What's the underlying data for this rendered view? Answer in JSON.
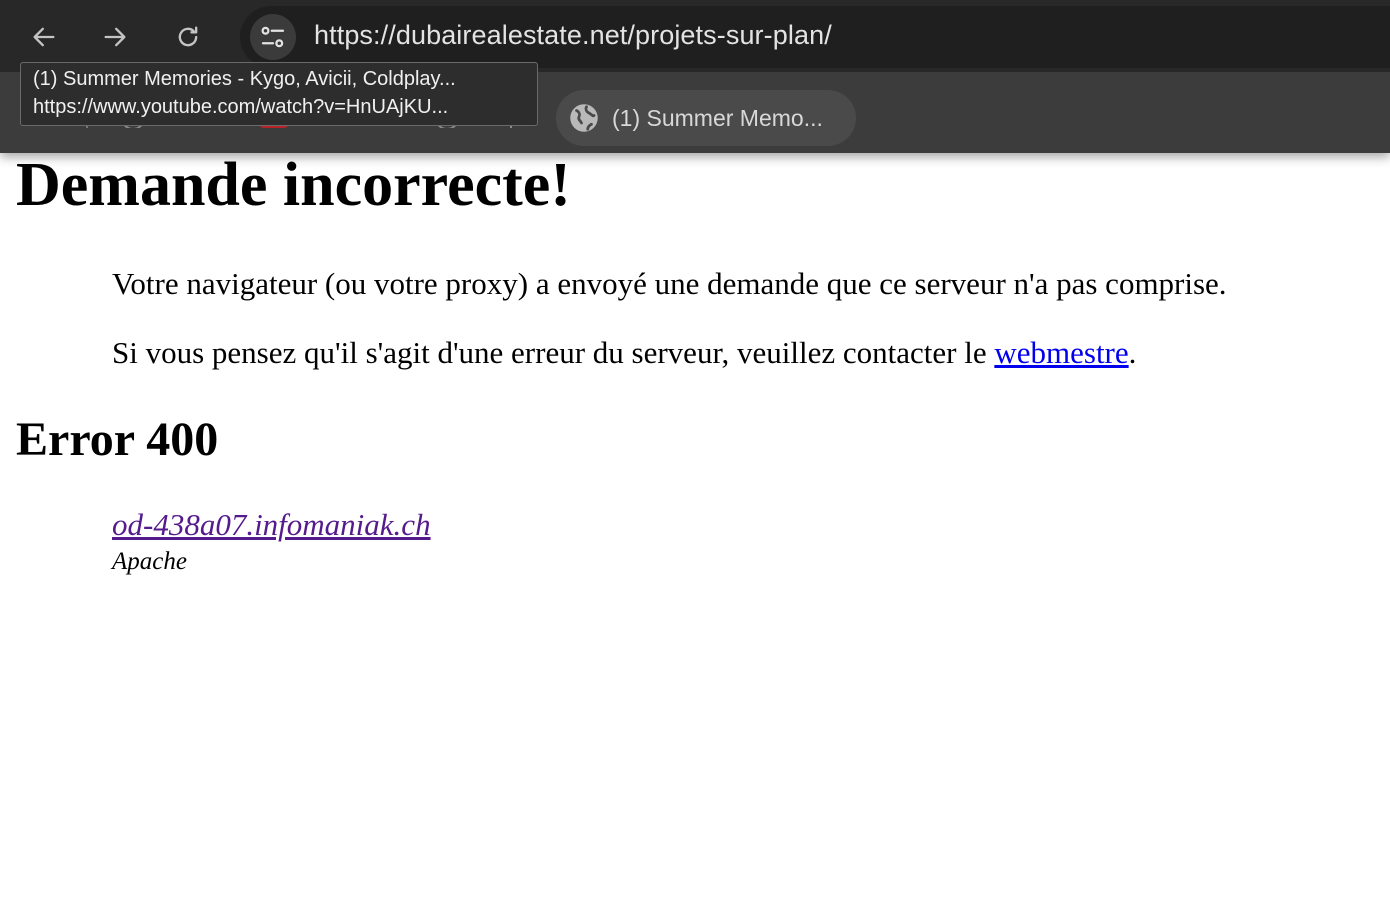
{
  "browser": {
    "url": "https://dubairealestate.net/projets-sur-plan/",
    "bookmark_chip_label": "(1) Summer Memo...",
    "tooltip": {
      "title": "(1) Summer Memories - Kygo, Avicii, Coldplay...",
      "url": "https://www.youtube.com/watch?v=HnUAjKU..."
    },
    "icons": {
      "back": "arrow-left-icon",
      "forward": "arrow-right-icon",
      "reload": "reload-icon",
      "site_info": "tune-icon",
      "bookmark": "globe-icon"
    }
  },
  "page": {
    "title": "Demande incorrecte!",
    "message": "Votre navigateur (ou votre proxy) a envoyé une demande que ce serveur n'a pas comprise.",
    "contact_text": "Si vous pensez qu'il s'agit d'une erreur du serveur, veuillez contacter le ",
    "contact_link": "webmestre",
    "contact_suffix": ".",
    "error_heading": "Error 400",
    "server_host": "od-438a07.infomaniak.ch",
    "server_software": "Apache"
  },
  "colors": {
    "link": "#0000ee",
    "visited_link": "#551a8b",
    "toolbar": "#282828",
    "bookmarks_bar": "#3c3c3c"
  }
}
